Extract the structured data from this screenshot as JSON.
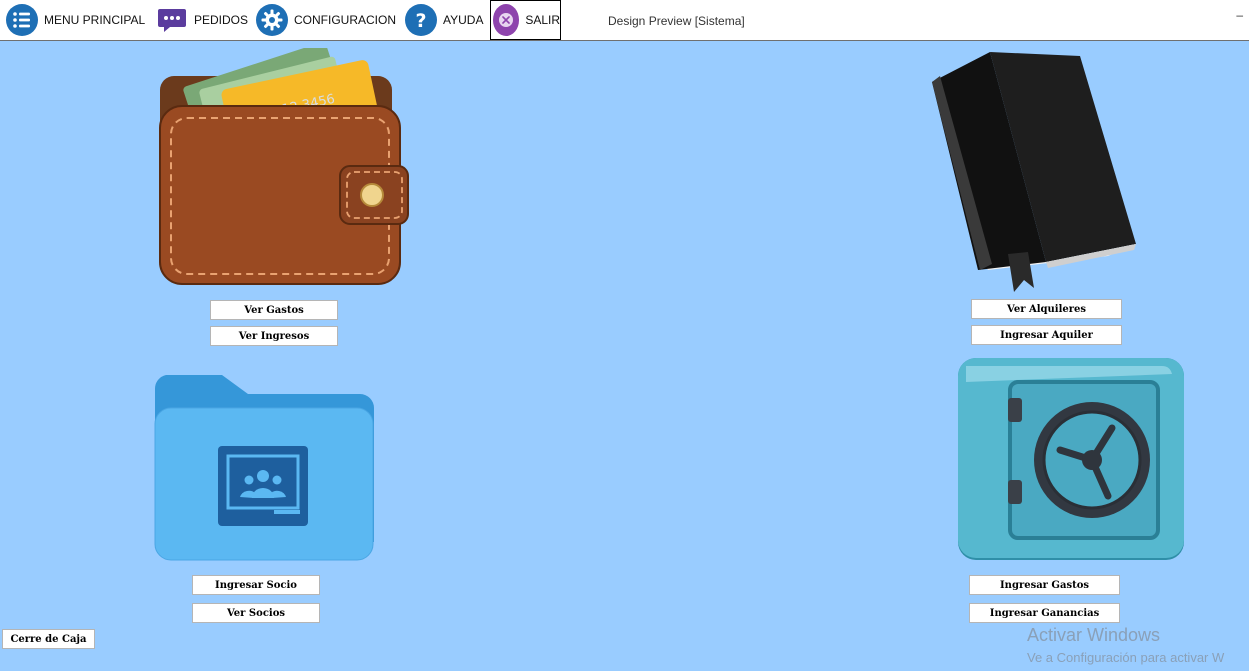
{
  "menu": {
    "items": [
      {
        "label": "MENU PRINCIPAL",
        "icon": "list-icon"
      },
      {
        "label": "PEDIDOS",
        "icon": "chat-icon"
      },
      {
        "label": "CONFIGURACION",
        "icon": "gear-icon"
      },
      {
        "label": "AYUDA",
        "icon": "help-icon"
      },
      {
        "label": "SALIR",
        "icon": "close-icon"
      }
    ],
    "window_title": "Design Preview [Sistema]",
    "minimize": "–"
  },
  "sections": {
    "gastos": {
      "buttons": [
        "Ver Gastos",
        "Ver Ingresos"
      ],
      "icon": "wallet-icon"
    },
    "alquileres": {
      "buttons": [
        "Ver Alquileres",
        "Ingresar Aquiler"
      ],
      "icon": "book-icon"
    },
    "socios": {
      "buttons": [
        "Ingresar Socio",
        "Ver Socios"
      ],
      "icon": "folder-icon"
    },
    "caja": {
      "buttons": [
        "Ingresar Gastos",
        "Ingresar Ganancias"
      ],
      "icon": "safe-icon"
    }
  },
  "cierre": {
    "label": "Cerre de Caja"
  },
  "watermark": {
    "title": "Activar Windows",
    "subtitle": "Ve a Configuración para activar W"
  },
  "colors": {
    "background": "#99ccff",
    "menubar": "#ffffff",
    "accent_blue": "#1e6fb5",
    "accent_purple": "#8e44ad"
  }
}
